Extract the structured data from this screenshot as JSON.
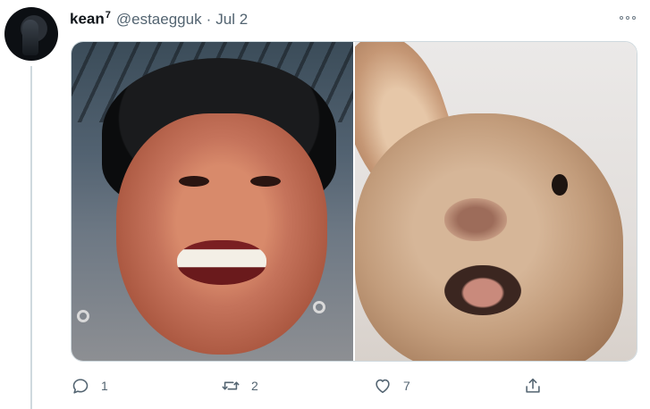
{
  "tweet": {
    "display_name": "kean",
    "display_name_sup": "7",
    "handle": "@estaegguk",
    "separator": "·",
    "date": "Jul 2"
  },
  "media": {
    "left_image": "photo-person-grimace",
    "right_image": "photo-rabbit-open-mouth"
  },
  "actions": {
    "reply_count": "1",
    "retweet_count": "2",
    "like_count": "7"
  },
  "colors": {
    "icon": "#536471",
    "thread_line": "#cfd9de",
    "border": "#cfd9de"
  }
}
